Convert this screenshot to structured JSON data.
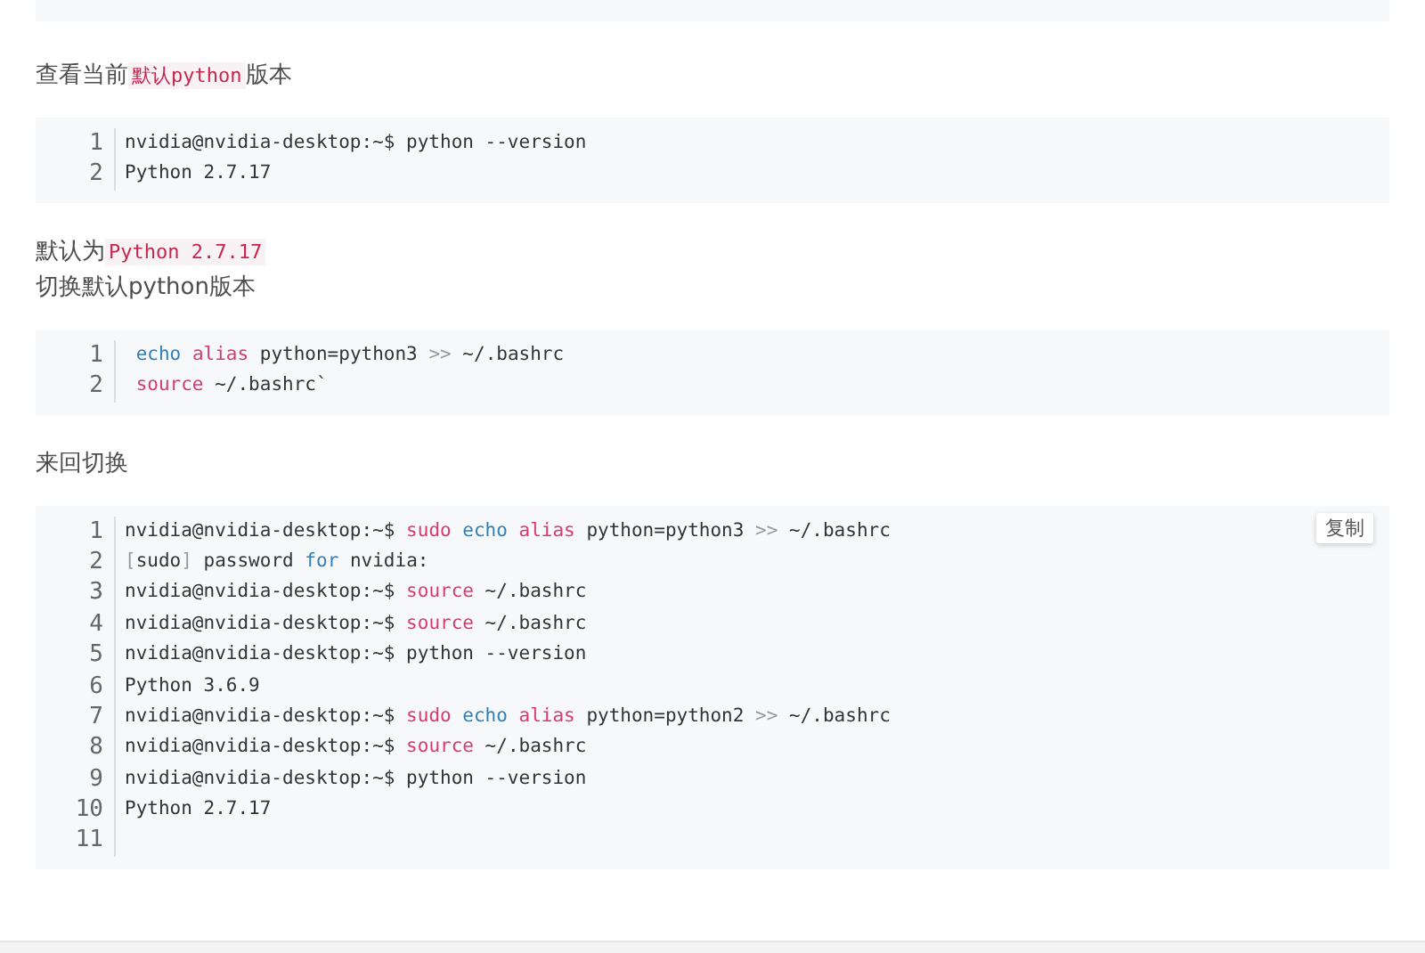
{
  "blocks": [
    {
      "kind": "para",
      "parts": [
        {
          "kind": "text",
          "text": "查看当前"
        },
        {
          "kind": "code",
          "text": "默认python"
        },
        {
          "kind": "text",
          "text": "版本"
        }
      ]
    },
    {
      "kind": "code",
      "lines": [
        {
          "number": "1",
          "tokens": [
            {
              "kind": "plain",
              "text": "nvidia@nvidia-desktop:~$ python --version"
            }
          ]
        },
        {
          "number": "2",
          "tokens": [
            {
              "kind": "plain",
              "text": "Python 2.7.17"
            }
          ]
        }
      ]
    },
    {
      "kind": "para",
      "parts": [
        {
          "kind": "text",
          "text": "默认为"
        },
        {
          "kind": "code",
          "text": "Python 2.7.17"
        }
      ]
    },
    {
      "kind": "para",
      "parts": [
        {
          "kind": "text",
          "text": "切换默认python版本"
        }
      ]
    },
    {
      "kind": "code",
      "lines": [
        {
          "number": "1",
          "tokens": [
            {
              "kind": "builtin",
              "text": " echo "
            },
            {
              "kind": "keyword",
              "text": "alias"
            },
            {
              "kind": "plain",
              "text": " python=python3 "
            },
            {
              "kind": "operator",
              "text": ">>"
            },
            {
              "kind": "plain",
              "text": " ~/.bashrc"
            }
          ]
        },
        {
          "number": "2",
          "tokens": [
            {
              "kind": "keyword",
              "text": " source"
            },
            {
              "kind": "plain",
              "text": " ~/.bashrc`"
            }
          ]
        }
      ]
    },
    {
      "kind": "para",
      "parts": [
        {
          "kind": "text",
          "text": "来回切换"
        }
      ]
    },
    {
      "kind": "code",
      "copy_button": "复制",
      "lines": [
        {
          "number": "1",
          "tokens": [
            {
              "kind": "plain",
              "text": "nvidia@nvidia-desktop:~$ "
            },
            {
              "kind": "keyword",
              "text": "sudo "
            },
            {
              "kind": "builtin",
              "text": "echo "
            },
            {
              "kind": "keyword",
              "text": "alias"
            },
            {
              "kind": "plain",
              "text": " python=python3 "
            },
            {
              "kind": "operator",
              "text": ">>"
            },
            {
              "kind": "plain",
              "text": " ~/.bashrc"
            }
          ]
        },
        {
          "number": "2",
          "tokens": [
            {
              "kind": "operator",
              "text": "["
            },
            {
              "kind": "plain",
              "text": "sudo"
            },
            {
              "kind": "operator",
              "text": "]"
            },
            {
              "kind": "plain",
              "text": " password "
            },
            {
              "kind": "builtin",
              "text": "for"
            },
            {
              "kind": "plain",
              "text": " nvidia:"
            }
          ]
        },
        {
          "number": "3",
          "tokens": [
            {
              "kind": "plain",
              "text": "nvidia@nvidia-desktop:~$ "
            },
            {
              "kind": "keyword",
              "text": "source"
            },
            {
              "kind": "plain",
              "text": " ~/.bashrc"
            }
          ]
        },
        {
          "number": "4",
          "tokens": [
            {
              "kind": "plain",
              "text": "nvidia@nvidia-desktop:~$ "
            },
            {
              "kind": "keyword",
              "text": "source"
            },
            {
              "kind": "plain",
              "text": " ~/.bashrc"
            }
          ]
        },
        {
          "number": "5",
          "tokens": [
            {
              "kind": "plain",
              "text": "nvidia@nvidia-desktop:~$ python --version"
            }
          ]
        },
        {
          "number": "6",
          "tokens": [
            {
              "kind": "plain",
              "text": "Python 3.6.9"
            }
          ]
        },
        {
          "number": "7",
          "tokens": [
            {
              "kind": "plain",
              "text": "nvidia@nvidia-desktop:~$ "
            },
            {
              "kind": "keyword",
              "text": "sudo "
            },
            {
              "kind": "builtin",
              "text": "echo "
            },
            {
              "kind": "keyword",
              "text": "alias"
            },
            {
              "kind": "plain",
              "text": " python=python2 "
            },
            {
              "kind": "operator",
              "text": ">>"
            },
            {
              "kind": "plain",
              "text": " ~/.bashrc"
            }
          ]
        },
        {
          "number": "8",
          "tokens": [
            {
              "kind": "plain",
              "text": "nvidia@nvidia-desktop:~$ "
            },
            {
              "kind": "keyword",
              "text": "source"
            },
            {
              "kind": "plain",
              "text": " ~/.bashrc"
            }
          ]
        },
        {
          "number": "9",
          "tokens": [
            {
              "kind": "plain",
              "text": "nvidia@nvidia-desktop:~$ python --version"
            }
          ]
        },
        {
          "number": "10",
          "tokens": [
            {
              "kind": "plain",
              "text": "Python 2.7.17"
            }
          ]
        },
        {
          "number": "11"
        }
      ]
    }
  ]
}
